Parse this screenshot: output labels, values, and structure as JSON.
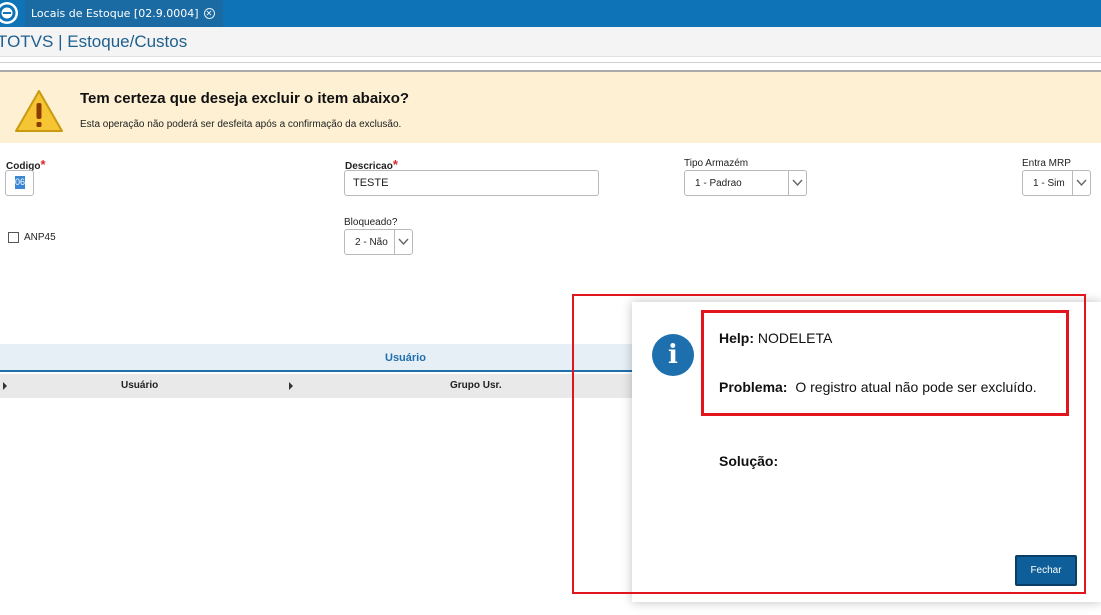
{
  "tab": {
    "title": "Locais de Estoque [02.9.0004]",
    "close_glyph": "✕"
  },
  "header": {
    "title": "TOTVS | Estoque/Custos"
  },
  "warning": {
    "title": "Tem certeza que deseja excluir o item abaixo?",
    "subtitle": "Esta operação não poderá ser desfeita após a confirmação da exclusão."
  },
  "form": {
    "codigo_label": "Codigo",
    "codigo_value": "06",
    "descricao_label": "Descricao",
    "descricao_value": "TESTE",
    "tipo_label": "Tipo Armazém",
    "tipo_value": "1 - Padrao",
    "mrp_label": "Entra MRP",
    "mrp_value": "1 - Sim",
    "anp_label": "ANP45",
    "bloqueado_label": "Bloqueado?",
    "bloqueado_value": "2 - Não",
    "required_mark": "*"
  },
  "grid": {
    "title": "Usuário",
    "columns": [
      "Usuário",
      "Grupo Usr."
    ]
  },
  "dialog": {
    "help_label": "Help:",
    "help_value": "NODELETA",
    "problem_label": "Problema:",
    "problem_value": "O registro atual não pode ser excluído.",
    "solution_label": "Solução:",
    "close_button": "Fechar",
    "info_glyph": "i"
  },
  "colors": {
    "accent": "#0f73b7",
    "warning_bg": "#fdf0d3",
    "annotation": "#e2141c"
  }
}
